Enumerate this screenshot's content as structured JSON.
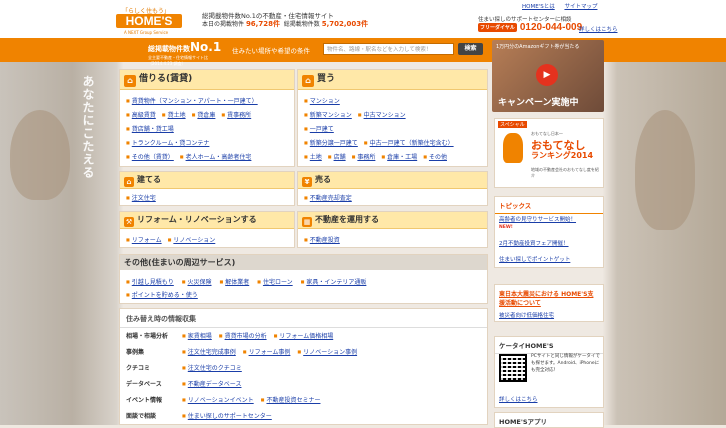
{
  "header": {
    "logo_tag": "「らしく住もう」",
    "logo_text": "HOME'S",
    "logo_sub": "A NEXT Group Service",
    "tagline": "総掲載物件数No.1の不動産・住宅情報サイト",
    "stats_label1": "本日の掲載物件",
    "stats_value1": "96,728件",
    "stats_label2": "総掲載物件数",
    "stats_value2": "5,702,003件",
    "toplink1": "HOME'Sとは",
    "toplink2": "サイトマップ",
    "support": "住まい探しのサポートセンターに相談",
    "freedial": "フリーダイヤル",
    "phone": "0120-044-009",
    "privacy": "詳しくはこちら"
  },
  "bar": {
    "no1_text": "総掲載物件数",
    "no1_big": "No.1",
    "no1_note": "全主要不動産・住宅情報サイト比（2014.4.23 調査）",
    "search_label": "住みたい場所や希望の条件",
    "search_placeholder": "物件名、路線・駅名などを入力して検索！",
    "search_button": "検索"
  },
  "hero": {
    "vertical_text": "あなたにこたえる"
  },
  "rent": {
    "title": "借りる(賃貸)",
    "rows": [
      [
        "賃貸物件（マンション・アパート・一戸建て）"
      ],
      [
        "高級賃貸",
        "貸土地",
        "貸倉庫",
        "賃事務所"
      ],
      [
        "貸店舗・貸工場"
      ],
      [
        "トランクルーム・貸コンテナ"
      ],
      [
        "その他（賃貸）",
        "老人ホーム・高齢者住宅"
      ]
    ]
  },
  "buy": {
    "title": "買う",
    "rows": [
      [
        "マンション"
      ],
      [
        "新築マンション",
        "中古マンション"
      ],
      [
        "一戸建て"
      ],
      [
        "新築分譲一戸建て",
        "中古一戸建て（新築住宅含む）"
      ],
      [
        "土地",
        "店舗",
        "事務所",
        "倉庫・工場",
        "その他"
      ]
    ]
  },
  "build": {
    "title": "建てる",
    "links": [
      "注文住宅"
    ]
  },
  "sell": {
    "title": "売る",
    "links": [
      "不動産売却査定"
    ]
  },
  "reform": {
    "title": "リフォーム・リノベーションする",
    "links": [
      "リフォーム",
      "リノベーション"
    ]
  },
  "invest": {
    "title": "不動産を運用する",
    "links": [
      "不動産投資"
    ]
  },
  "other": {
    "title": "その他(住まいの周辺サービス)",
    "row1": [
      "引越し見積もり",
      "火災保険",
      "解体業者",
      "住宅ローン",
      "家具・インテリア通販"
    ],
    "row2": [
      "ポイントを貯める・使う"
    ]
  },
  "info": {
    "title": "住み替え時の情報収集",
    "rows": [
      {
        "cat": "相場・市場分析",
        "links": [
          "家賃相場",
          "賃貸市場の分析",
          "リフォーム価格相場"
        ]
      },
      {
        "cat": "事例集",
        "links": [
          "注文住宅完成事例",
          "リフォーム事例",
          "リノベーション事例"
        ]
      },
      {
        "cat": "クチコミ",
        "links": [
          "注文住宅のクチコミ"
        ]
      },
      {
        "cat": "データベース",
        "links": [
          "不動産データベース"
        ]
      },
      {
        "cat": "イベント情報",
        "links": [
          "リノベーションイベント",
          "不動産投資セミナー"
        ]
      },
      {
        "cat": "面談で相談",
        "links": [
          "住まい探しのサポートセンター"
        ]
      }
    ]
  },
  "right": {
    "banner1_top": "1万円分のAmazonギフト券が当たる",
    "banner1_campaign": "キャンペーン実施中",
    "banner2_special": "スペシャル",
    "banner2_small": "おもてなし日本一",
    "banner2_title": "おもてなし",
    "banner2_rank": "ランキング2014",
    "banner2_desc": "地域の不動産会社のおもてなし度を紹介",
    "topics_title": "トピックス",
    "topics": [
      "高齢者の見守りサービス開始！",
      "2月不動産投資フェア開催！",
      "住まい探しでポイントゲット"
    ],
    "new_badge": "NEW!",
    "eq_title": "東日本大震災における HOME'S支援活動について",
    "eq_link": "被災者向け低価格住宅",
    "mobile_title": "ケータイHOME'S",
    "mobile_text": "PCサイトと同じ情報がケータイでも探せます。Android、iPhoneにも完全対応！",
    "mobile_link": "詳しくはこちら",
    "app_title": "HOME'Sアプリ"
  }
}
